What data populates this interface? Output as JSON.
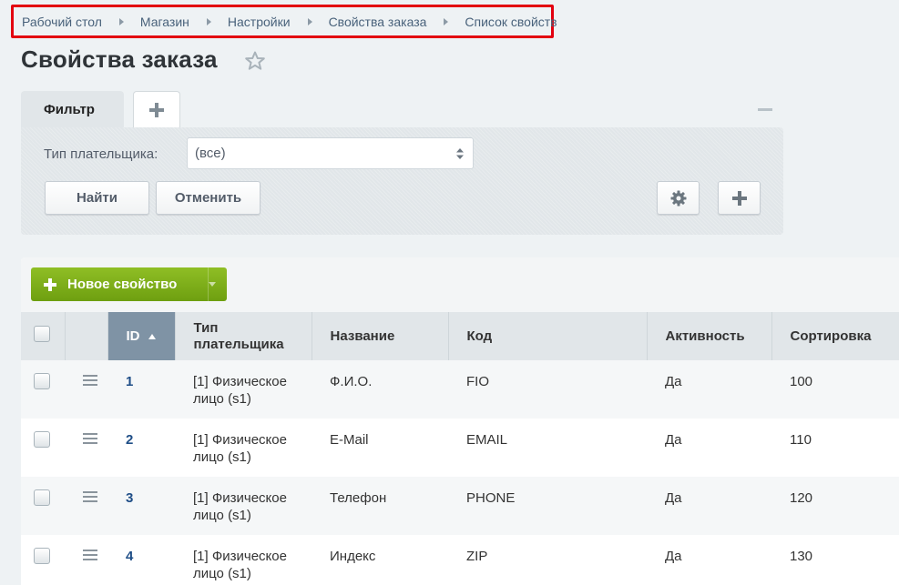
{
  "breadcrumb": [
    "Рабочий стол",
    "Магазин",
    "Настройки",
    "Свойства заказа",
    "Список свойств"
  ],
  "page_title": "Свойства заказа",
  "filter": {
    "tab_label": "Фильтр",
    "payer_label": "Тип плательщика:",
    "payer_value": "(все)",
    "find_label": "Найти",
    "cancel_label": "Отменить"
  },
  "toolbar": {
    "new_property_label": "Новое свойство"
  },
  "table": {
    "headers": {
      "id": "ID",
      "payer_type_line1": "Тип",
      "payer_type_line2": "плательщика",
      "name": "Название",
      "code": "Код",
      "active": "Активность",
      "sort": "Сортировка"
    },
    "rows": [
      {
        "id": "1",
        "payer_line1": "[1] Физическое",
        "payer_line2": "лицо (s1)",
        "name": "Ф.И.О.",
        "code": "FIO",
        "active": "Да",
        "sort": "100"
      },
      {
        "id": "2",
        "payer_line1": "[1] Физическое",
        "payer_line2": "лицо (s1)",
        "name": "E-Mail",
        "code": "EMAIL",
        "active": "Да",
        "sort": "110"
      },
      {
        "id": "3",
        "payer_line1": "[1] Физическое",
        "payer_line2": "лицо (s1)",
        "name": "Телефон",
        "code": "PHONE",
        "active": "Да",
        "sort": "120"
      },
      {
        "id": "4",
        "payer_line1": "[1] Физическое",
        "payer_line2": "лицо (s1)",
        "name": "Индекс",
        "code": "ZIP",
        "active": "Да",
        "sort": "130"
      }
    ]
  },
  "colors": {
    "accent_green": "#7aab16",
    "sorted_header": "#7f93a5",
    "breadcrumb_highlight": "#e3000f",
    "link": "#1f4e87"
  }
}
